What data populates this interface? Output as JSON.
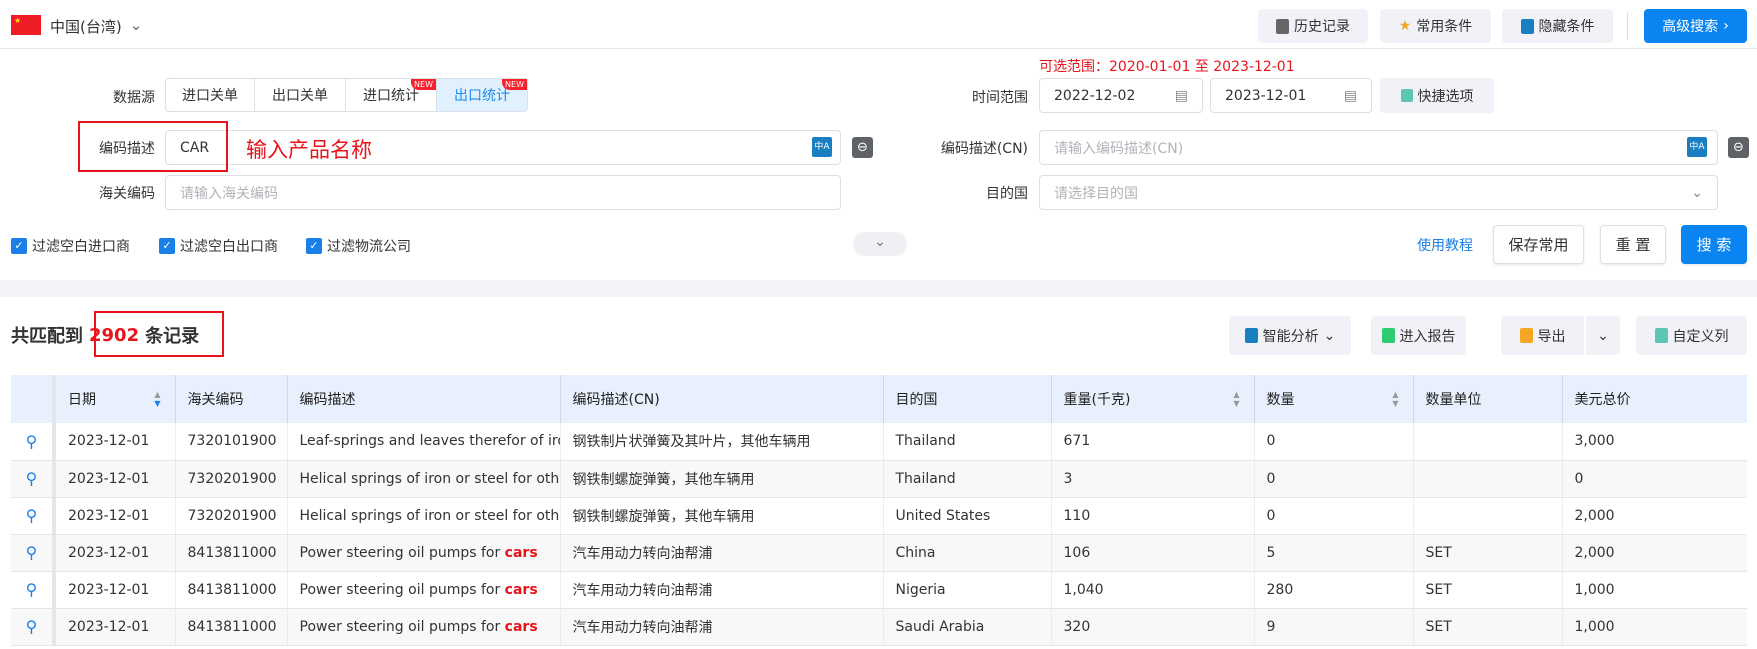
{
  "header": {
    "country": "中国(台湾)",
    "history": "历史记录",
    "favorites": "常用条件",
    "hide": "隐藏条件",
    "advanced": "高级搜索"
  },
  "filters": {
    "range_note": "可选范围：2020-01-01 至 2023-12-01",
    "data_source_label": "数据源",
    "sources": [
      {
        "label": "进口关单"
      },
      {
        "label": "出口关单"
      },
      {
        "label": "进口统计",
        "badge": "NEW"
      },
      {
        "label": "出口统计",
        "badge": "NEW"
      }
    ],
    "time_label": "时间范围",
    "date_start": "2022-12-02",
    "date_end": "2023-12-01",
    "quick": "快捷选项",
    "desc_label": "编码描述",
    "desc_value": "CAR",
    "annotation": "输入产品名称",
    "desc_cn_label": "编码描述(CN)",
    "desc_cn_placeholder": "请输入编码描述(CN)",
    "hs_label": "海关编码",
    "hs_placeholder": "请输入海关编码",
    "dest_label": "目的国",
    "dest_placeholder": "请选择目的国",
    "checks": [
      "过滤空白进口商",
      "过滤空白出口商",
      "过滤物流公司"
    ],
    "tutorial": "使用教程",
    "save": "保存常用",
    "reset": "重 置",
    "search": "搜 索"
  },
  "results": {
    "prefix": "共匹配到",
    "count": "2902",
    "suffix": "条记录",
    "analysis": "智能分析",
    "report": "进入报告",
    "export": "导出",
    "columns_btn": "自定义列"
  },
  "table": {
    "columns": [
      "日期",
      "海关编码",
      "编码描述",
      "编码描述(CN)",
      "目的国",
      "重量(千克)",
      "数量",
      "数量单位",
      "美元总价"
    ],
    "rows": [
      {
        "date": "2023-12-01",
        "hs": "7320101900",
        "desc": "Leaf-springs and leaves therefor of iro",
        "hl": "",
        "cn": "钢铁制片状弹簧及其叶片，其他车辆用",
        "dest": "Thailand",
        "weight": "671",
        "qty": "0",
        "unit": "",
        "usd": "3,000"
      },
      {
        "date": "2023-12-01",
        "hs": "7320201900",
        "desc": "Helical springs of iron or steel for othe",
        "hl": "",
        "cn": "钢铁制螺旋弹簧，其他车辆用",
        "dest": "Thailand",
        "weight": "3",
        "qty": "0",
        "unit": "",
        "usd": "0"
      },
      {
        "date": "2023-12-01",
        "hs": "7320201900",
        "desc": "Helical springs of iron or steel for othe",
        "hl": "",
        "cn": "钢铁制螺旋弹簧，其他车辆用",
        "dest": "United States",
        "weight": "110",
        "qty": "0",
        "unit": "",
        "usd": "2,000"
      },
      {
        "date": "2023-12-01",
        "hs": "8413811000",
        "desc": "Power steering oil pumps for ",
        "hl": "cars",
        "cn": "汽车用动力转向油帮浦",
        "dest": "China",
        "weight": "106",
        "qty": "5",
        "unit": "SET",
        "usd": "2,000"
      },
      {
        "date": "2023-12-01",
        "hs": "8413811000",
        "desc": "Power steering oil pumps for ",
        "hl": "cars",
        "cn": "汽车用动力转向油帮浦",
        "dest": "Nigeria",
        "weight": "1,040",
        "qty": "280",
        "unit": "SET",
        "usd": "1,000"
      },
      {
        "date": "2023-12-01",
        "hs": "8413811000",
        "desc": "Power steering oil pumps for ",
        "hl": "cars",
        "cn": "汽车用动力转向油帮浦",
        "dest": "Saudi Arabia",
        "weight": "320",
        "qty": "9",
        "unit": "SET",
        "usd": "1,000"
      }
    ]
  }
}
